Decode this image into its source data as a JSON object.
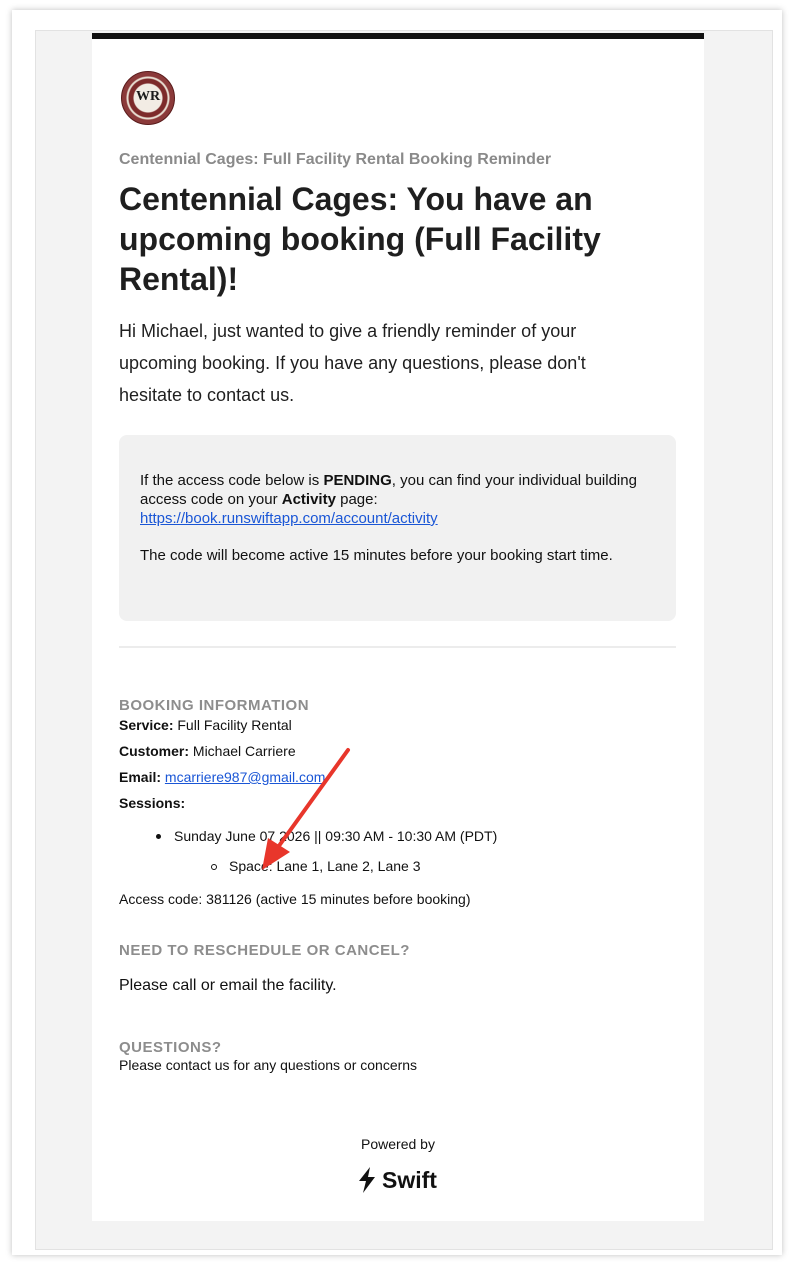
{
  "email": {
    "logo_text": "WR",
    "preheader": "Centennial Cages: Full Facility Rental Booking Reminder",
    "headline": "Centennial Cages: You have an upcoming booking (Full Facility Rental)!",
    "intro": "Hi Michael, just wanted to give a friendly reminder of your upcoming booking. If you have any questions, please don't hesitate to contact us.",
    "notice": {
      "text_before_pending": "If the access code below is ",
      "pending_word": "PENDING",
      "text_after_pending": ", you can find your individual building access code on your ",
      "activity_word": "Activity",
      "text_after_activity": " page:",
      "activity_link": "https://book.runswiftapp.com/account/activity",
      "active_note": "The code will become active 15 minutes before your booking start time."
    },
    "booking": {
      "title": "BOOKING INFORMATION",
      "service_label": "Service:",
      "service_value": "Full Facility Rental",
      "customer_label": "Customer:",
      "customer_value": "Michael Carriere",
      "email_label": "Email:",
      "email_value": "mcarriere987@gmail.com",
      "sessions_label": "Sessions:",
      "session_line": "Sunday June 07 2026 || 09:30 AM - 10:30 AM (PDT)",
      "space_line": "Space: Lane 1, Lane 2, Lane 3",
      "access_code_line": "Access code: 381126 (active 15 minutes before booking)"
    },
    "reschedule": {
      "title": "NEED TO RESCHEDULE OR CANCEL?",
      "text": "Please call or email the facility."
    },
    "questions": {
      "title": "QUESTIONS?",
      "text": "Please contact us for any questions or concerns"
    },
    "footer": {
      "powered_by": "Powered by",
      "brand": "Swift"
    }
  },
  "colors": {
    "link": "#1a56d6",
    "section_title": "#8d8d8d",
    "annotation_arrow": "#e8362b"
  }
}
